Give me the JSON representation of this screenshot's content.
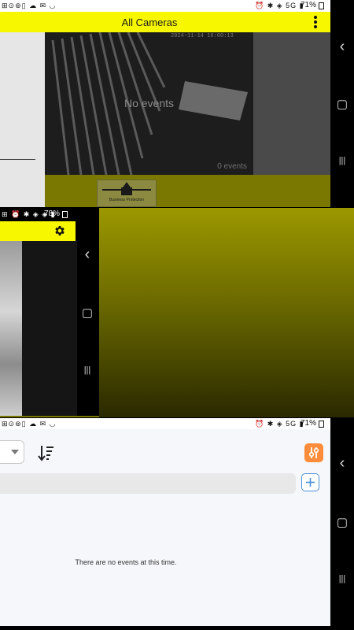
{
  "panel1": {
    "status": {
      "left_icons": "⊞⊙⊚▯ ☁ ✉ ◡",
      "right_icons": "⏰ ✱ ◈ 5G ▮",
      "battery": "71%"
    },
    "app_bar": {
      "title": "All Cameras"
    },
    "video": {
      "timestamp": "2024-11-14 16:00:13",
      "empty_label": "No events",
      "event_count": "0 events"
    },
    "logo_caption": "Business Protection"
  },
  "panel2": {
    "status": {
      "left_icons": "⊞ ⏰ ✱ ◈ ◈ ▮",
      "battery": "78%"
    }
  },
  "panel3": {
    "status": {
      "left_icons": "⊞⊙⊚▯ ☁ ✉ ◡",
      "right_icons": "⏰ ✱ ◈ 5G ▮",
      "battery": "71%"
    },
    "empty_message": "There are no events at this time."
  },
  "navigation": {
    "back": "‹",
    "home": "▢",
    "recents": "|||"
  },
  "colors": {
    "accent_yellow": "#f7f700",
    "filter_orange": "#ff8c3a",
    "add_blue": "#4a90d9"
  }
}
